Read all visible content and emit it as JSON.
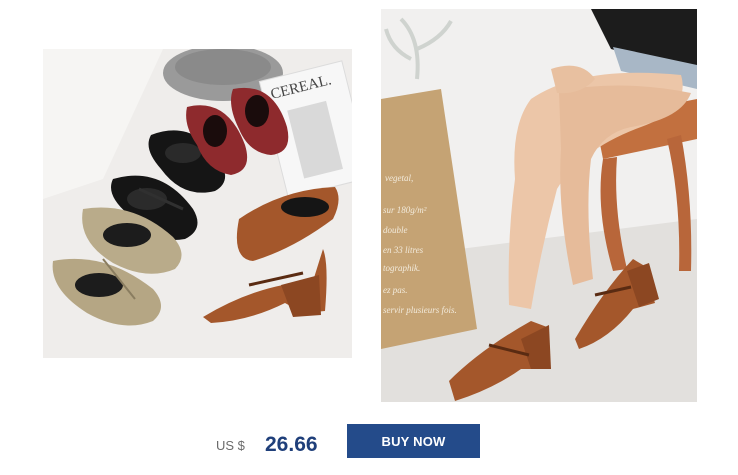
{
  "product": {
    "images": [
      {
        "name": "shoe-collection-photo",
        "magazine_text": "CEREAL."
      },
      {
        "name": "model-wearing-shoe-photo",
        "bag_text": [
          "vegetal,",
          "sur 180g/m²",
          "double",
          "en 33 litres",
          "tographik.",
          "ez pas.",
          "servir plusieurs fois."
        ]
      }
    ],
    "price": {
      "currency": "US $",
      "amount": "26.66"
    },
    "buy_label": "BUY NOW"
  },
  "colors": {
    "button_bg": "#244b8a",
    "price_text": "#1f3f7a",
    "shoe_black": "#151515",
    "shoe_red": "#8e2a2d",
    "shoe_gold": "#b9ab8a",
    "shoe_tan": "#a4572b"
  }
}
